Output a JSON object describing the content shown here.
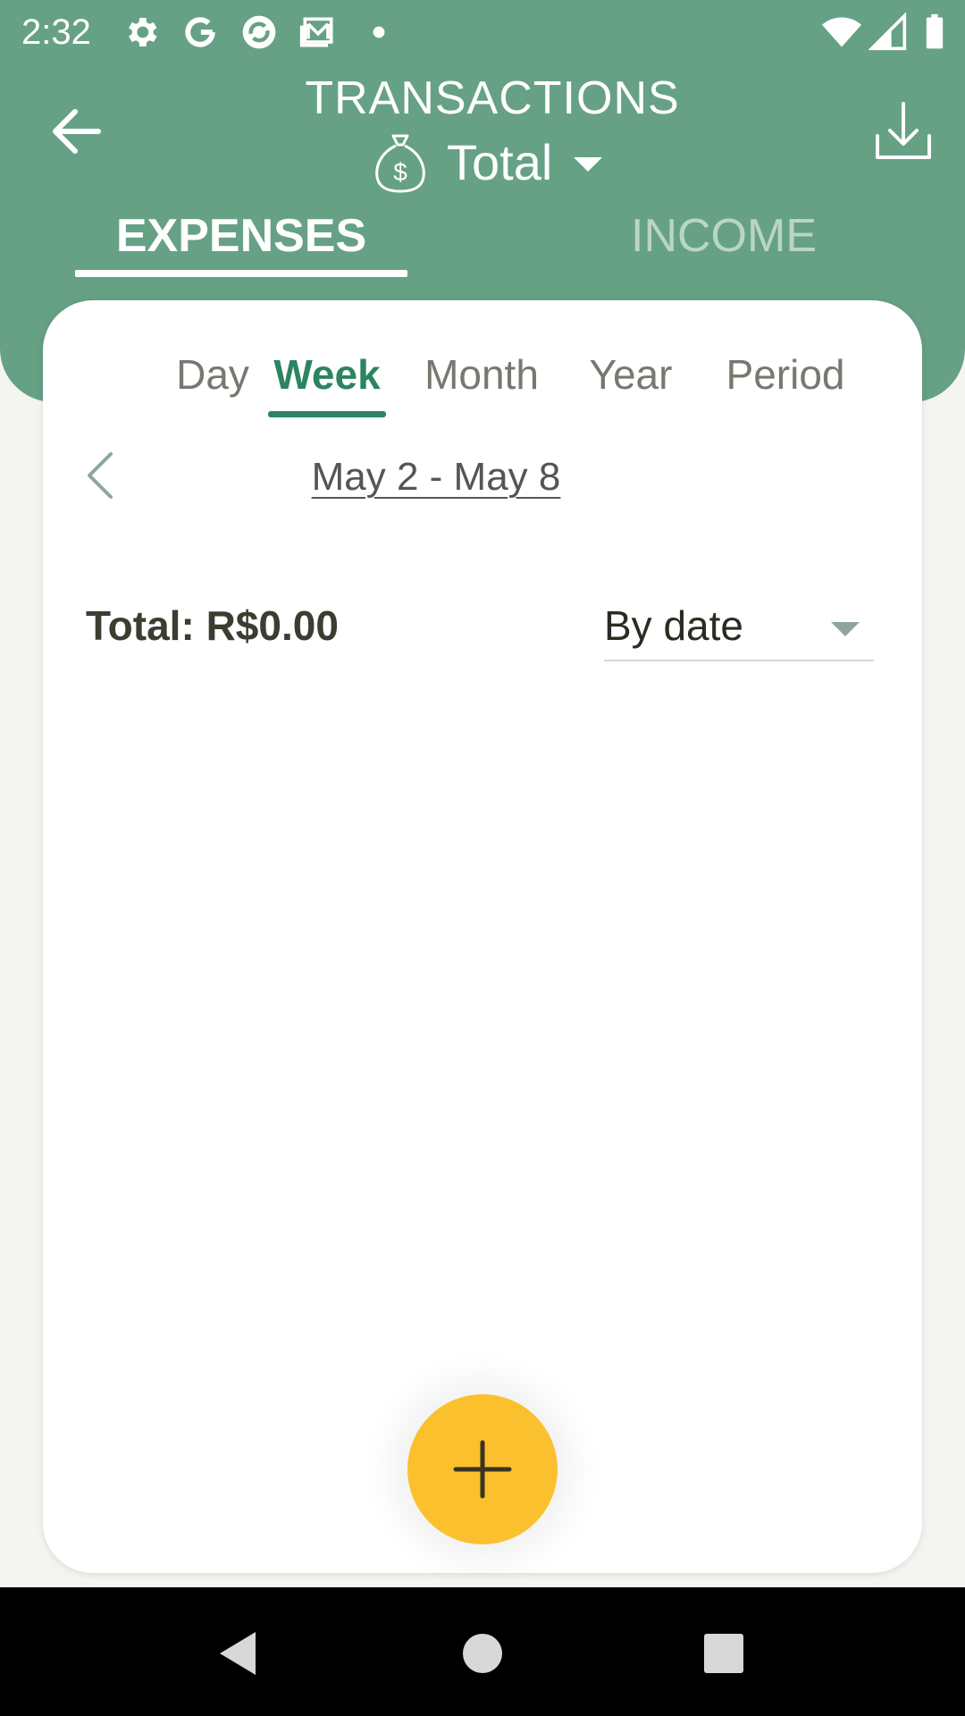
{
  "status_bar": {
    "time": "2:32",
    "icons": [
      "gear-icon",
      "google-icon",
      "sync-app-icon",
      "mail-icon",
      "dot-icon",
      "wifi-icon",
      "signal-icon",
      "battery-icon"
    ]
  },
  "app_bar": {
    "title": "TRANSACTIONS",
    "account": "Total",
    "back_icon": "arrow-back-icon",
    "download_icon": "download-icon"
  },
  "main_tabs": [
    {
      "label": "EXPENSES",
      "active": true
    },
    {
      "label": "INCOME",
      "active": false
    }
  ],
  "period_tabs": [
    {
      "label": "Day",
      "active": false
    },
    {
      "label": "Week",
      "active": true
    },
    {
      "label": "Month",
      "active": false
    },
    {
      "label": "Year",
      "active": false
    },
    {
      "label": "Period",
      "active": false
    }
  ],
  "date_range": "May 2 - May 8",
  "summary": {
    "total": "Total: R$0.00",
    "sort": "By date"
  },
  "colors": {
    "header": "#66a185",
    "accent": "#2c8460",
    "fab": "#fbc02d",
    "card": "#ffffff",
    "background": "#f4f4f1"
  }
}
